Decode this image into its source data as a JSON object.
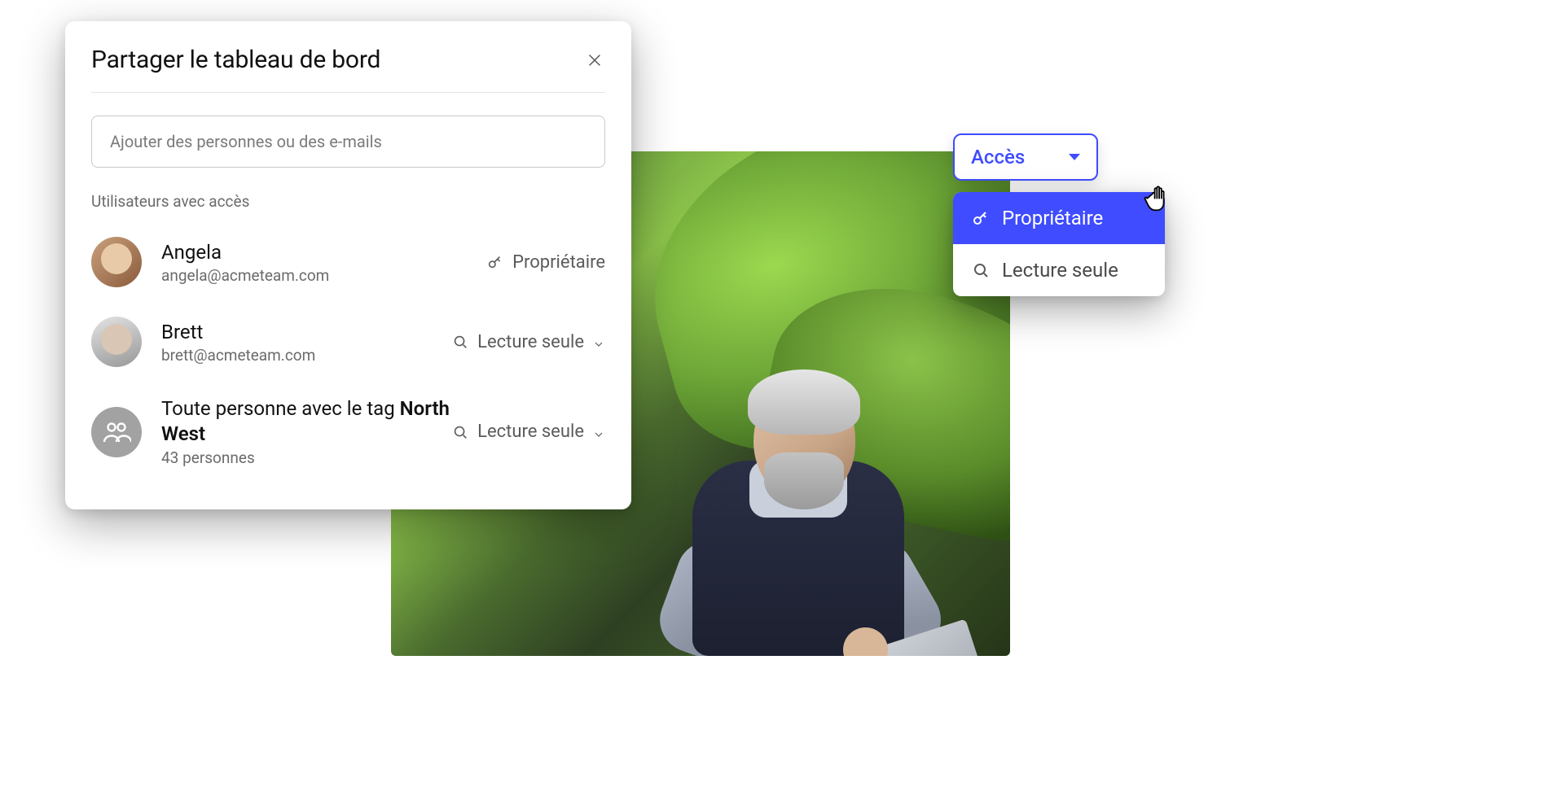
{
  "modal": {
    "title": "Partager le tableau de bord",
    "input_placeholder": "Ajouter des personnes ou des e-mails",
    "section_label": "Utilisateurs avec accès",
    "users": [
      {
        "name": "Angela",
        "email": "angela@acmeteam.com",
        "role": "Propriétaire",
        "role_kind": "owner",
        "has_chevron": false
      },
      {
        "name": "Brett",
        "email": "brett@acmeteam.com",
        "role": "Lecture seule",
        "role_kind": "read",
        "has_chevron": true
      }
    ],
    "group": {
      "prefix": "Toute personne avec le tag",
      "tag_name": "North West",
      "count_label": "43 personnes",
      "role": "Lecture seule",
      "role_kind": "read",
      "has_chevron": true
    }
  },
  "access_dropdown": {
    "trigger_label": "Accès",
    "options": [
      {
        "label": "Propriétaire",
        "kind": "owner",
        "selected": true
      },
      {
        "label": "Lecture seule",
        "kind": "read",
        "selected": false
      }
    ]
  },
  "colors": {
    "accent": "#3f4cff"
  }
}
